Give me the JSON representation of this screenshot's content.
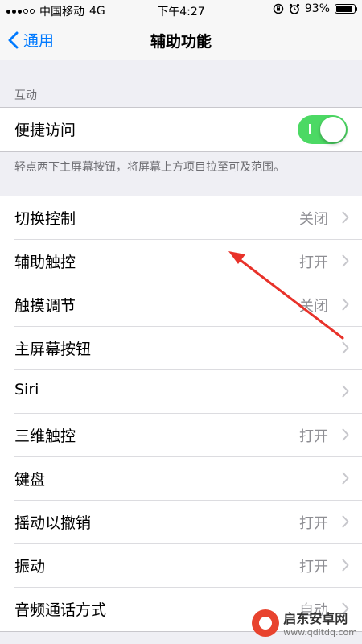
{
  "status_bar": {
    "carrier": "中国移动",
    "network": "4G",
    "time": "下午4:27",
    "battery": "93%",
    "battery_level": 0.93
  },
  "nav": {
    "back_label": "通用",
    "title": "辅助功能"
  },
  "interaction_section": {
    "header": "互动",
    "reachability": {
      "label": "便捷访问",
      "enabled": true
    },
    "footer": "轻点两下主屏幕按钮，将屏幕上方项目拉至可及范围。"
  },
  "settings": [
    {
      "label": "切换控制",
      "value": "关闭"
    },
    {
      "label": "辅助触控",
      "value": "打开"
    },
    {
      "label": "触摸调节",
      "value": "关闭"
    },
    {
      "label": "主屏幕按钮",
      "value": ""
    },
    {
      "label": "Siri",
      "value": ""
    },
    {
      "label": "三维触控",
      "value": "打开"
    },
    {
      "label": "键盘",
      "value": ""
    },
    {
      "label": "摇动以撤销",
      "value": "打开"
    },
    {
      "label": "振动",
      "value": "打开"
    },
    {
      "label": "音频通话方式",
      "value": "自动"
    }
  ],
  "watermark": {
    "title": "启东安卓网",
    "url": "www.qdltdq.com"
  },
  "colors": {
    "accent": "#007aff",
    "toggle_on": "#4cd964",
    "annotation_arrow": "#e8322a"
  }
}
